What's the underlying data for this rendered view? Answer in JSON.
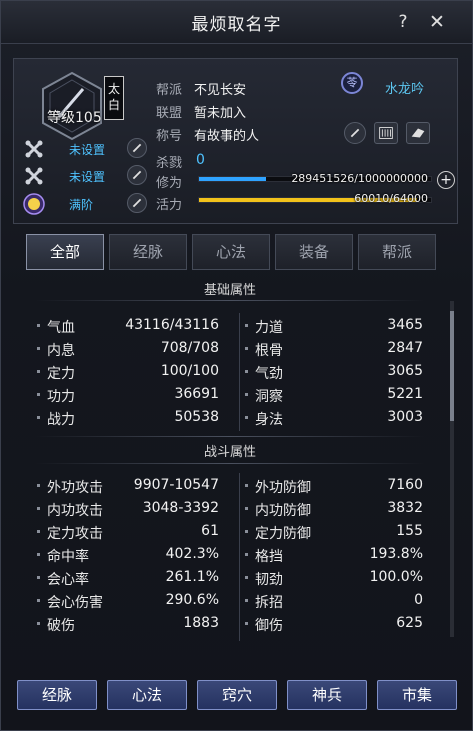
{
  "window": {
    "title": "最烦取名字",
    "help_label": "?",
    "close_label": "✕"
  },
  "profile": {
    "level_text": "等级105",
    "school": "太白",
    "slots": [
      {
        "icon": "bone-icon",
        "label": "未设置"
      },
      {
        "icon": "bone-icon",
        "label": "未设置"
      },
      {
        "icon": "max-badge-icon",
        "badge": "满阶",
        "label": "满阶"
      }
    ],
    "gang_label": "帮派",
    "gang_value": "不见长安",
    "alliance_label": "联盟",
    "alliance_value": "暂未加入",
    "title_label": "称号",
    "title_value": "有故事的人",
    "faction_icon_char": "苓",
    "faction_name": "水龙吟",
    "kill_label": "杀戮",
    "kill_value": "0",
    "cultivation_label": "修为",
    "cultivation_text": "289451526/1000000000",
    "cultivation_fraction": 0.289,
    "vitality_label": "活力",
    "vitality_text": "60010/64000",
    "vitality_fraction": 0.938,
    "plus_label": "+"
  },
  "tabs": [
    {
      "label": "全部",
      "active": true
    },
    {
      "label": "经脉",
      "active": false
    },
    {
      "label": "心法",
      "active": false
    },
    {
      "label": "装备",
      "active": false
    },
    {
      "label": "帮派",
      "active": false
    }
  ],
  "basic": {
    "header": "基础属性",
    "left": [
      {
        "name": "气血",
        "value": "43116/43116"
      },
      {
        "name": "内息",
        "value": "708/708"
      },
      {
        "name": "定力",
        "value": "100/100"
      },
      {
        "name": "功力",
        "value": "36691"
      },
      {
        "name": "战力",
        "value": "50538"
      }
    ],
    "right": [
      {
        "name": "力道",
        "value": "3465"
      },
      {
        "name": "根骨",
        "value": "2847"
      },
      {
        "name": "气劲",
        "value": "3065"
      },
      {
        "name": "洞察",
        "value": "5221"
      },
      {
        "name": "身法",
        "value": "3003"
      }
    ]
  },
  "combat": {
    "header": "战斗属性",
    "left": [
      {
        "name": "外功攻击",
        "value": "9907-10547"
      },
      {
        "name": "内功攻击",
        "value": "3048-3392"
      },
      {
        "name": "定力攻击",
        "value": "61"
      },
      {
        "name": "命中率",
        "value": "402.3%"
      },
      {
        "name": "会心率",
        "value": "261.1%"
      },
      {
        "name": "会心伤害",
        "value": "290.6%"
      },
      {
        "name": "破伤",
        "value": "1883"
      }
    ],
    "right": [
      {
        "name": "外功防御",
        "value": "7160"
      },
      {
        "name": "内功防御",
        "value": "3832"
      },
      {
        "name": "定力防御",
        "value": "155"
      },
      {
        "name": "格挡",
        "value": "193.8%"
      },
      {
        "name": "韧劲",
        "value": "100.0%"
      },
      {
        "name": "拆招",
        "value": "0"
      },
      {
        "name": "御伤",
        "value": "625"
      }
    ]
  },
  "bottom_buttons": [
    "经脉",
    "心法",
    "窍穴",
    "神兵",
    "市集"
  ],
  "colors": {
    "accent_blue": "#4fc3ff",
    "cultivation_bar": "#2fa3ff",
    "vitality_bar": "#f2c21b"
  }
}
